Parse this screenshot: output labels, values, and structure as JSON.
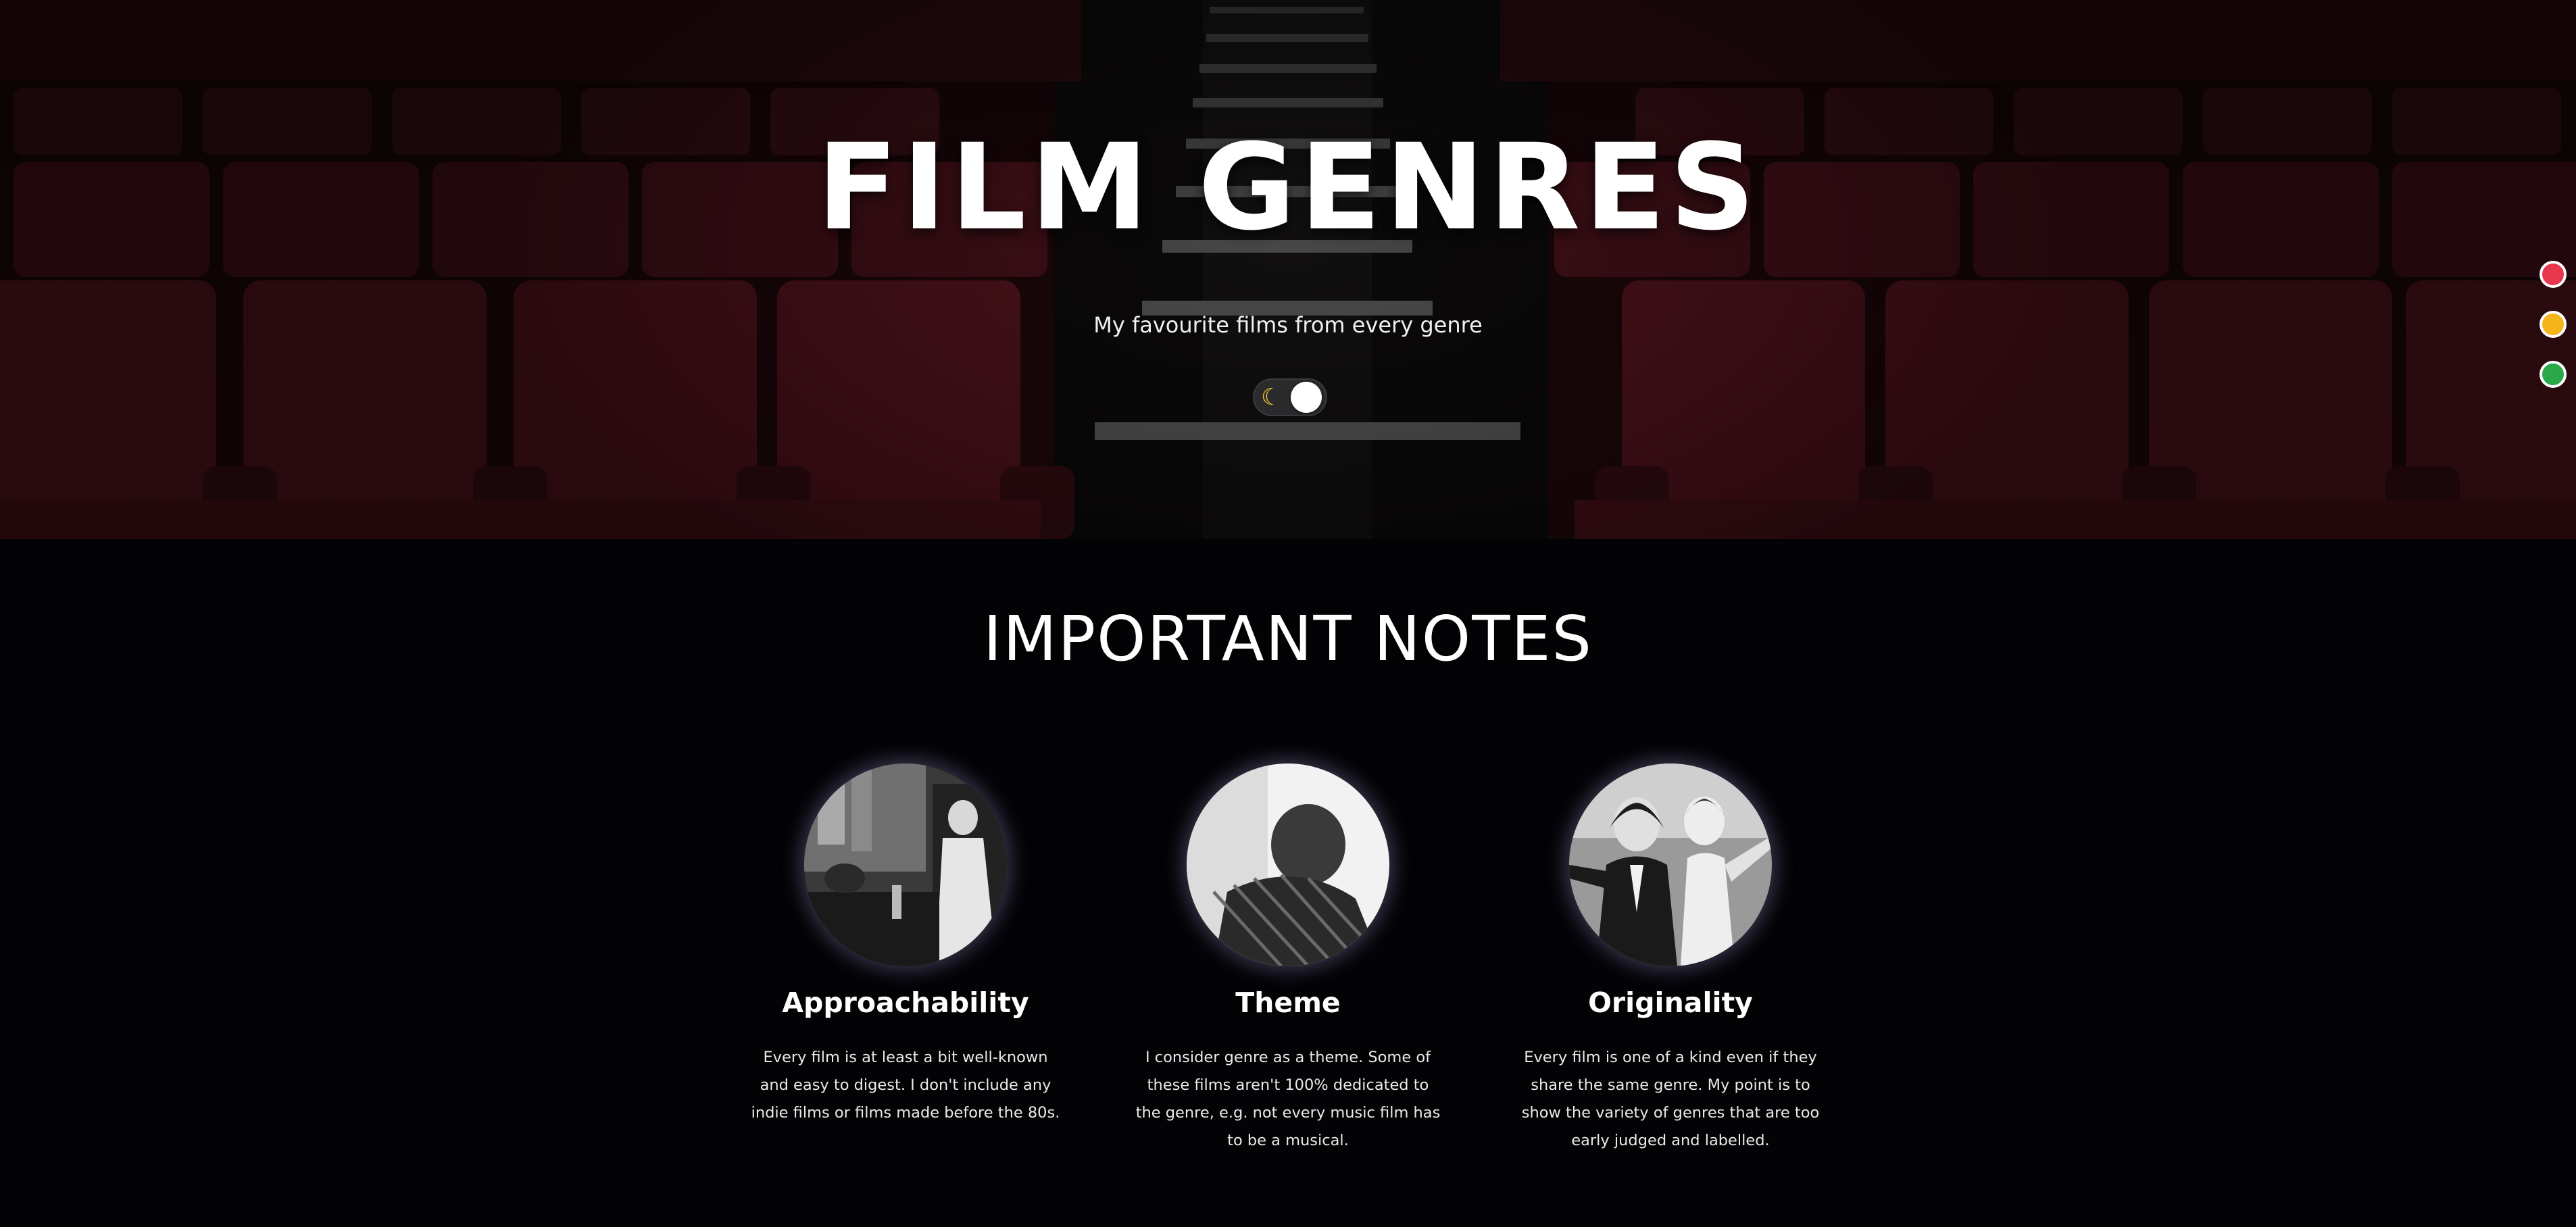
{
  "hero": {
    "title": "FILM GENRES",
    "subtitle": "My favourite films from every genre",
    "toggle_icon": "moon-icon",
    "background": "cinema-seats-photo"
  },
  "side_nav": {
    "dots": [
      {
        "name": "red-dot",
        "color": "#e8364f"
      },
      {
        "name": "yellow-dot",
        "color": "#f4b41a"
      },
      {
        "name": "green-dot",
        "color": "#2ba84a"
      }
    ]
  },
  "notes": {
    "title": "IMPORTANT NOTES",
    "items": [
      {
        "heading": "Approachability",
        "text": "Every film is at least a bit well-known and easy to digest. I don't include any indie films or films made before the 80s.",
        "image": "black-and-white-film-still"
      },
      {
        "heading": "Theme",
        "text": "I consider genre as a theme. Some of these films aren't 100% dedicated to the genre, e.g. not every music film has to be a musical.",
        "image": "black-and-white-film-still"
      },
      {
        "heading": "Originality",
        "text": "Every film is one of a kind even if they share the same genre. My point is to show the variety of genres that are too early judged and labelled.",
        "image": "black-and-white-film-still"
      }
    ]
  }
}
